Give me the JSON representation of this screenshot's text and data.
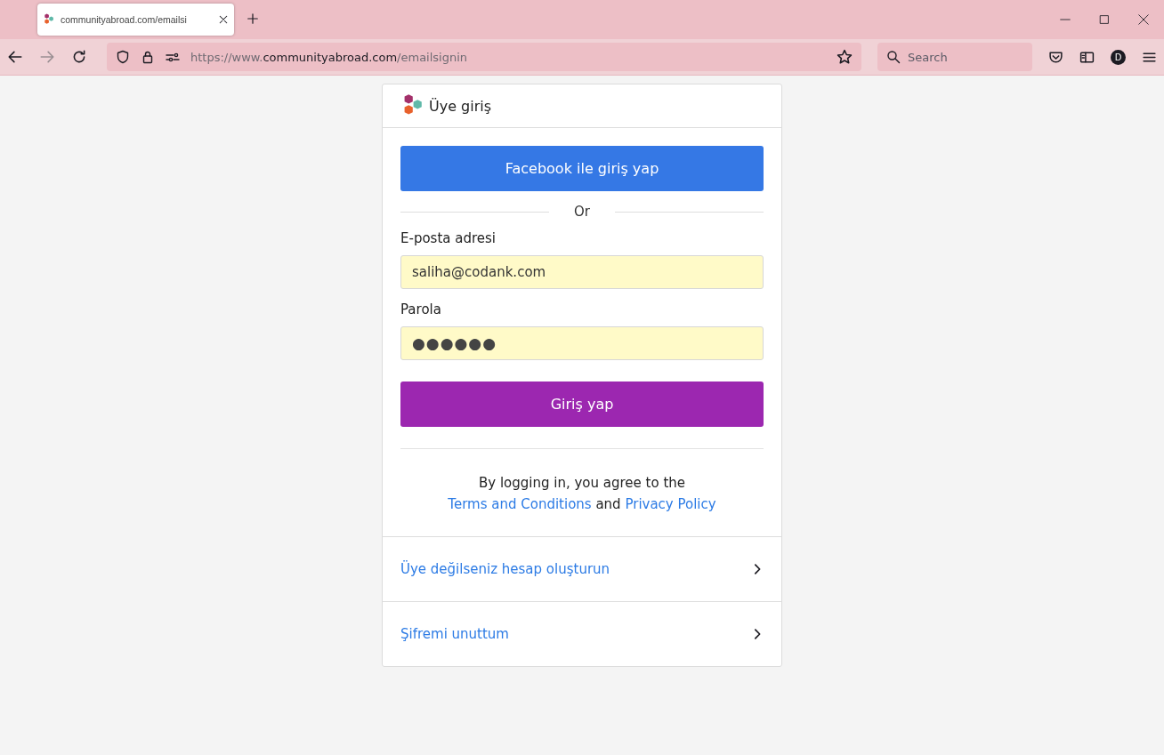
{
  "browser": {
    "tab": {
      "title": "communityabroad.com/emailsi",
      "selected": true
    },
    "url": {
      "prefix": "https://www.",
      "domain": "communityabroad.com",
      "path": "/emailsignin"
    },
    "search": {
      "placeholder": "Search"
    },
    "profile_initial": "D"
  },
  "card": {
    "title": "Üye giriş",
    "facebook_button": "Facebook ile giriş yap",
    "divider_text": "Or",
    "fields": [
      {
        "label": "E-posta adresi",
        "value": "saliha@codank.com",
        "kind": "email"
      },
      {
        "label": "Parola",
        "value": "●●●●●●",
        "kind": "password"
      }
    ],
    "submit_button": "Giriş yap",
    "terms": {
      "text": "By logging in, you agree to the",
      "terms_link": "Terms and Conditions",
      "joiner": "and",
      "privacy_link": "Privacy Policy"
    },
    "links": [
      "Üye değilseniz hesap oluşturun",
      "Şifremi unuttum"
    ]
  }
}
